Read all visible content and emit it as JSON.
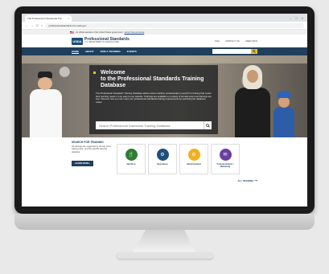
{
  "browser": {
    "tab_title": "The Professional Standards Trai",
    "tab_close": "×",
    "window_controls": [
      "–",
      "□",
      "×"
    ],
    "nav_icons": [
      "←",
      "→",
      "C",
      "⌂"
    ],
    "url": "professionalstandards.fns.usda.gov"
  },
  "gov_banner": {
    "text": "An official website of the United States government",
    "link": "Here's how you know"
  },
  "header": {
    "logo": "USDA",
    "title": "Professional Standards",
    "subtitle": "U.S. DEPARTMENT OF AGRICULTURE",
    "links": [
      "FAQ",
      "CONTACT US",
      "USER INFO"
    ]
  },
  "nav": {
    "items": [
      "HOME",
      "ABOUT",
      "FIND A TRAINING",
      "EVENTS"
    ],
    "search_icon": "magnifier-icon"
  },
  "hero": {
    "title": "Welcome\nto the Professional Standards Training Database",
    "description": "The Professional Standards Training Database allows school nutrition professionals to search for training that meets their learning needs in one easy to use website. Trainings are available in a variety of formats and most trainings are free. Discover how you can meet your professional standards training requirements by searching the database today!",
    "search_placeholder": "Search Professional Standards Training Database"
  },
  "training": {
    "heading": "SEARCH FOR TRAINING",
    "intro": "All trainings are organized by the key area, training topic, and the specific learning objective.",
    "learn_more": "LEARN MORE ›",
    "cards": [
      {
        "label": "Nutrition",
        "color": "#2e7d32",
        "icon": "🍴"
      },
      {
        "label": "Operations",
        "color": "#1f4e79",
        "icon": "⚙"
      },
      {
        "label": "Administration",
        "color": "#f0b020",
        "icon": "⚙"
      },
      {
        "label": "Communication /\nMarketing",
        "color": "#6a3fa0",
        "icon": "✉"
      }
    ],
    "all_training": "ALL TRAINING ⟶"
  }
}
